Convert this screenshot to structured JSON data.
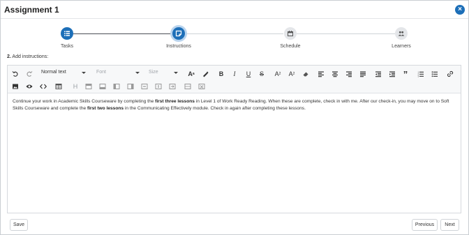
{
  "dialog": {
    "title": "Assignment 1",
    "close_glyph": "×"
  },
  "stepper": {
    "steps": [
      {
        "label": "Tasks",
        "icon": "list-icon",
        "state": "complete"
      },
      {
        "label": "Instructions",
        "icon": "note-icon",
        "state": "current"
      },
      {
        "label": "Schedule",
        "icon": "calendar-icon",
        "state": "pending"
      },
      {
        "label": "Learners",
        "icon": "people-icon",
        "state": "pending"
      }
    ]
  },
  "section": {
    "number": "2.",
    "label": "Add instructions:"
  },
  "toolbar": {
    "paragraph_style": "Normal text",
    "font": "Font",
    "size": "Size",
    "heading_label": "H",
    "blockquote_glyph": "”"
  },
  "content": {
    "p1": "Continue your work in Academic Skills Courseware by completing the ",
    "p1_bold": "first three lessons",
    "p2": " in Level 1 of Work Ready Reading. When these are complete, check in with me. After our check-in, you may move on to Soft Skills Courseware and complete the ",
    "p2_bold": "first two lessons",
    "p3": " in the Communicating Effectively module. Check in again after completing these lessons."
  },
  "footer": {
    "save_label": "Save",
    "previous_label": "Previous",
    "next_label": "Next"
  },
  "colors": {
    "accent": "#1d6fb8",
    "accent_ring": "#b9d4ee",
    "pending_step": "#e4e6e9"
  }
}
